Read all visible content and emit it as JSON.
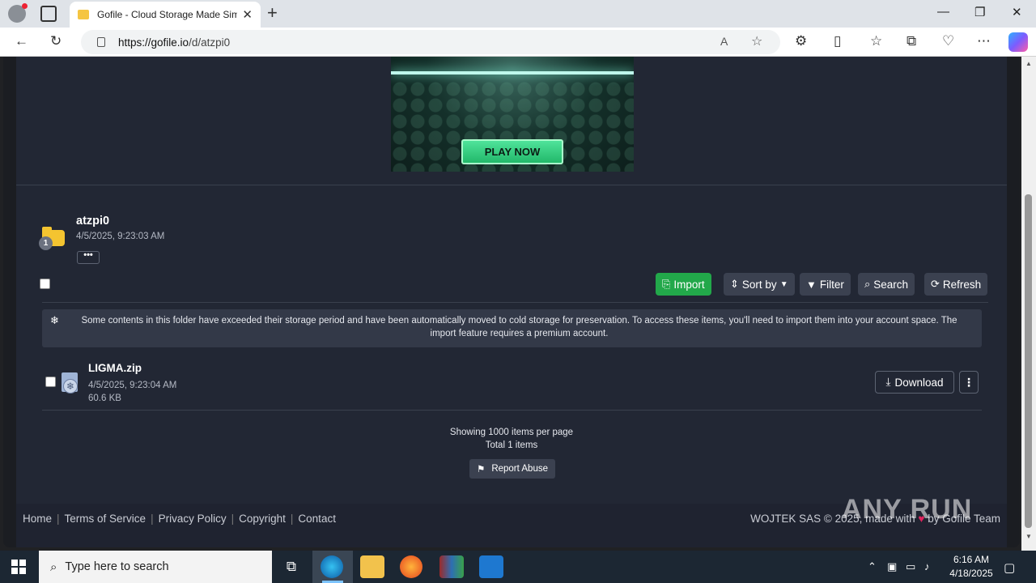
{
  "browser": {
    "tab_title": "Gofile - Cloud Storage Made Sim",
    "url_host": "https://gofile.io",
    "url_path": "/d/atzpi0"
  },
  "ad": {
    "cta": "PLAY NOW"
  },
  "folder": {
    "name": "atzpi0",
    "date": "4/5/2025, 9:23:03 AM",
    "badge_count": "1",
    "more_label": "•••"
  },
  "actions": {
    "import": "Import",
    "sort": "Sort by",
    "filter": "Filter",
    "search": "Search",
    "refresh": "Refresh"
  },
  "notice": "Some contents in this folder have exceeded their storage period and have been automatically moved to cold storage for preservation. To access these items, you'll need to import them into your account space. The import feature requires a premium account.",
  "files": [
    {
      "name": "LIGMA.zip",
      "date": "4/5/2025, 9:23:04 AM",
      "size": "60.6 KB",
      "download_label": "Download"
    }
  ],
  "paging": {
    "per_page": "Showing 1000 items per page",
    "total": "Total 1 items",
    "report": "Report Abuse"
  },
  "footer": {
    "links": [
      "Home",
      "Terms of Service",
      "Privacy Policy",
      "Copyright",
      "Contact"
    ],
    "copyright_prefix": "WOJTEK SAS © 2025, made with",
    "copyright_suffix": "by Gofile Team"
  },
  "watermark": "ANY RUN",
  "taskbar": {
    "search_placeholder": "Type here to search",
    "time": "6:16 AM",
    "date": "4/18/2025"
  },
  "colors": {
    "page_bg": "#222734",
    "import_green": "#22a84a",
    "folder_yellow": "#f4c430"
  }
}
